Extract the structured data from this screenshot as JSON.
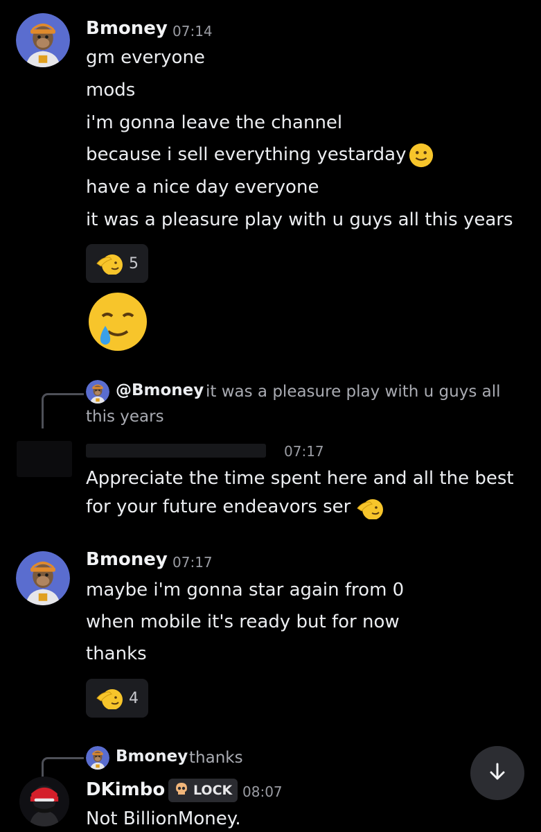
{
  "messages": [
    {
      "username": "Bmoney",
      "time": "07:14",
      "lines": [
        "gm everyone",
        "mods",
        "i'm gonna leave the channel",
        "because i sell everything yestarday",
        "have a nice day everyone",
        "it was a pleasure play with u guys all this years"
      ],
      "reaction": {
        "emoji": "saluting-face",
        "count": "5"
      },
      "big_emoji": "smiling-face-with-tear"
    },
    {
      "reply_to": {
        "mention": "@Bmoney",
        "text_line1": "it was a pleasure play with u guys all",
        "text_line2": "this years"
      },
      "time": "07:17",
      "lines": [
        "Appreciate the time spent here and all the best",
        "for your future endeavors ser"
      ]
    },
    {
      "username": "Bmoney",
      "time": "07:17",
      "lines": [
        "maybe i'm gonna star again from 0",
        "when mobile it's ready but for now",
        "thanks"
      ],
      "reaction": {
        "emoji": "saluting-face",
        "count": "4"
      }
    },
    {
      "reply_to": {
        "username": "Bmoney",
        "text": "thanks"
      },
      "username": "DKimbo",
      "badge": "LOCK",
      "time": "08:07",
      "lines": [
        "Not BillionMoney."
      ]
    }
  ],
  "scroll_button_icon": "arrow-down-icon"
}
